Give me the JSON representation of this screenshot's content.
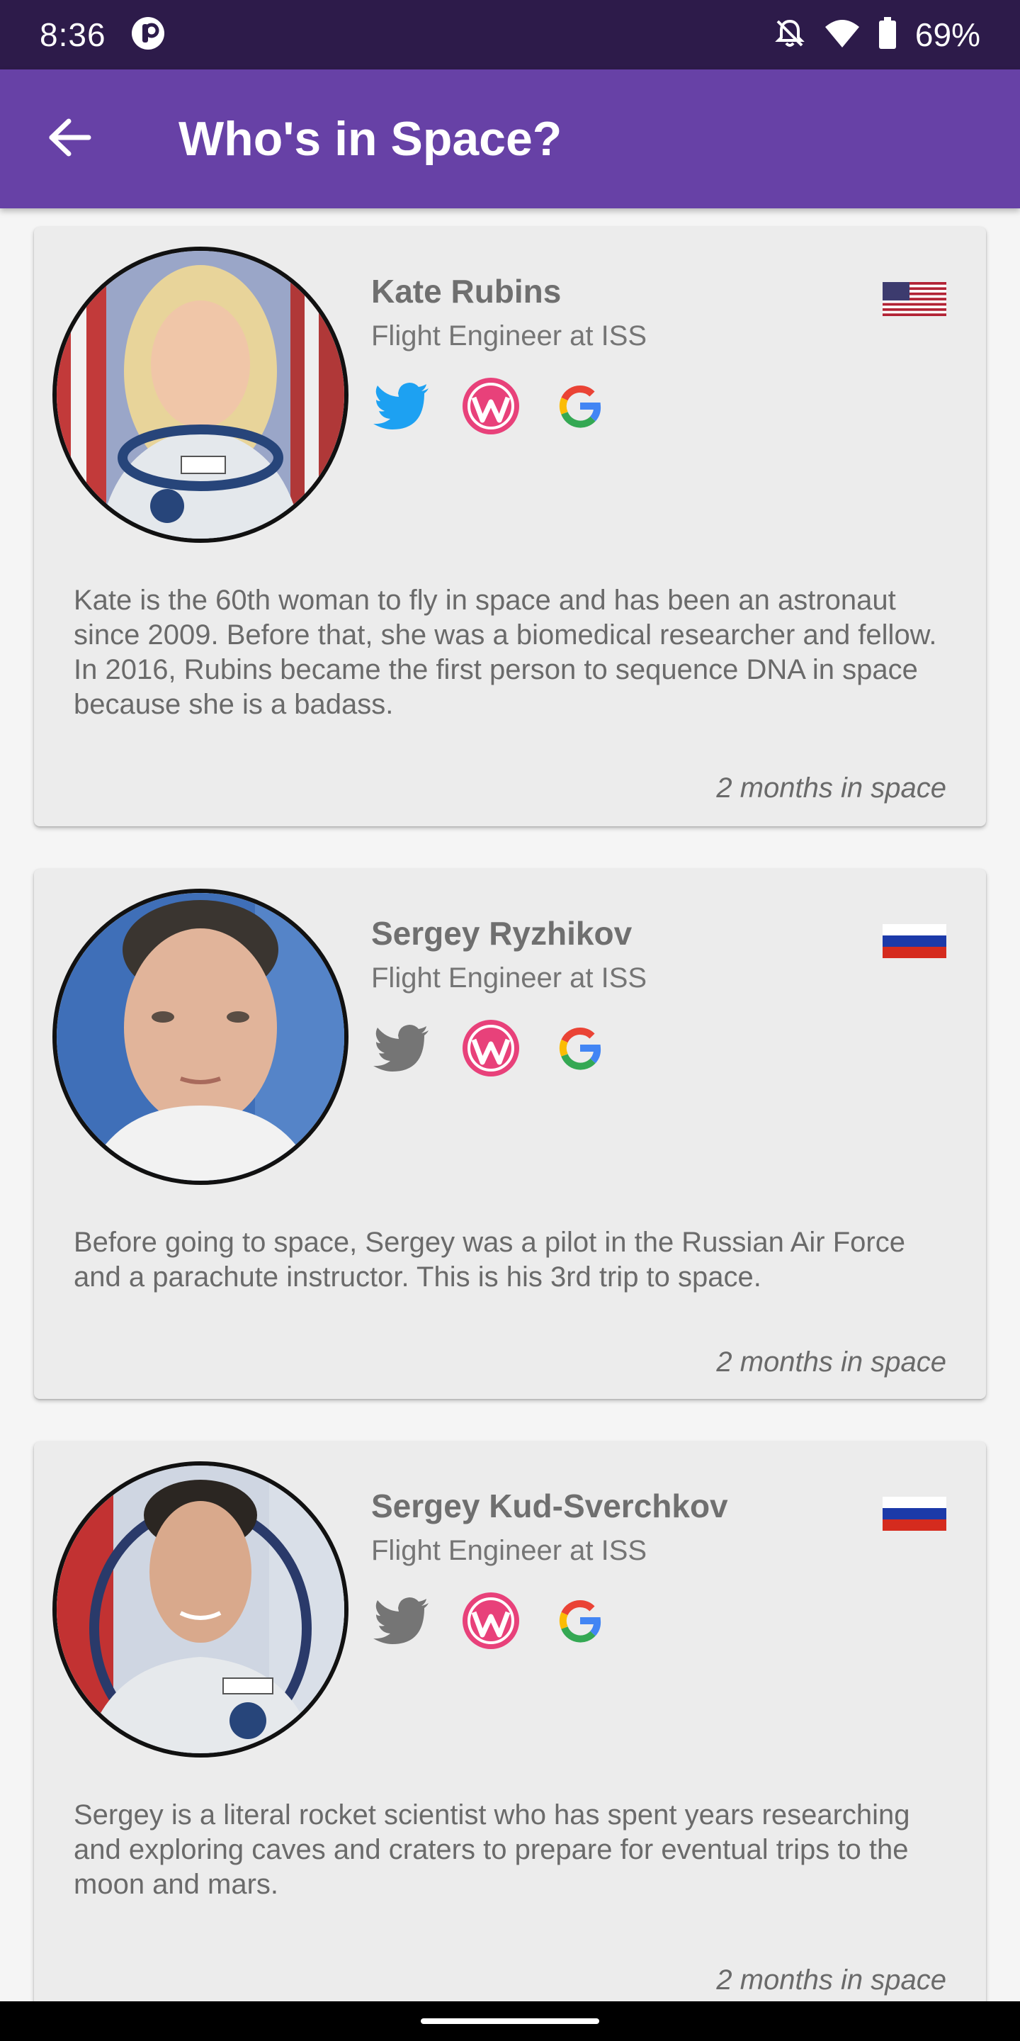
{
  "status_bar": {
    "time": "8:36",
    "battery": "69%",
    "icons": [
      "app-indicator-icon",
      "notifications-off-icon",
      "wifi-icon",
      "battery-icon"
    ]
  },
  "app_bar": {
    "title": "Who's in Space?",
    "back_icon": "arrow-back-icon",
    "background_color": "#6741a6"
  },
  "astronauts": [
    {
      "name": "Kate Rubins",
      "role": "Flight Engineer at ISS",
      "country_flag": "usa-flag-icon",
      "twitter_active": true,
      "bio": "Kate is the 60th woman to fly in space and has been an astronaut since 2009. Before that, she was a biomedical researcher and fellow. In 2016, Rubins became the first person to sequence DNA in space because she is a badass.",
      "duration": "2 months in space"
    },
    {
      "name": "Sergey Ryzhikov",
      "role": "Flight Engineer at ISS",
      "country_flag": "russia-flag-icon",
      "twitter_active": false,
      "bio": "Before going to space, Sergey was a pilot in the Russian Air Force and a parachute instructor. This is his 3rd trip to space.",
      "duration": "2 months in space"
    },
    {
      "name": "Sergey Kud-Sverchkov",
      "role": "Flight Engineer at ISS",
      "country_flag": "russia-flag-icon",
      "twitter_active": false,
      "bio": "Sergey is a literal rocket scientist who has spent years researching and exploring caves and craters to prepare for eventual trips to the moon and mars.",
      "duration": "2 months in space"
    }
  ],
  "colors": {
    "twitter_active": "#1da1f2",
    "twitter_inactive": "#757575",
    "wordpress": "#e8417a",
    "status_bar": "#2d1b4a"
  }
}
